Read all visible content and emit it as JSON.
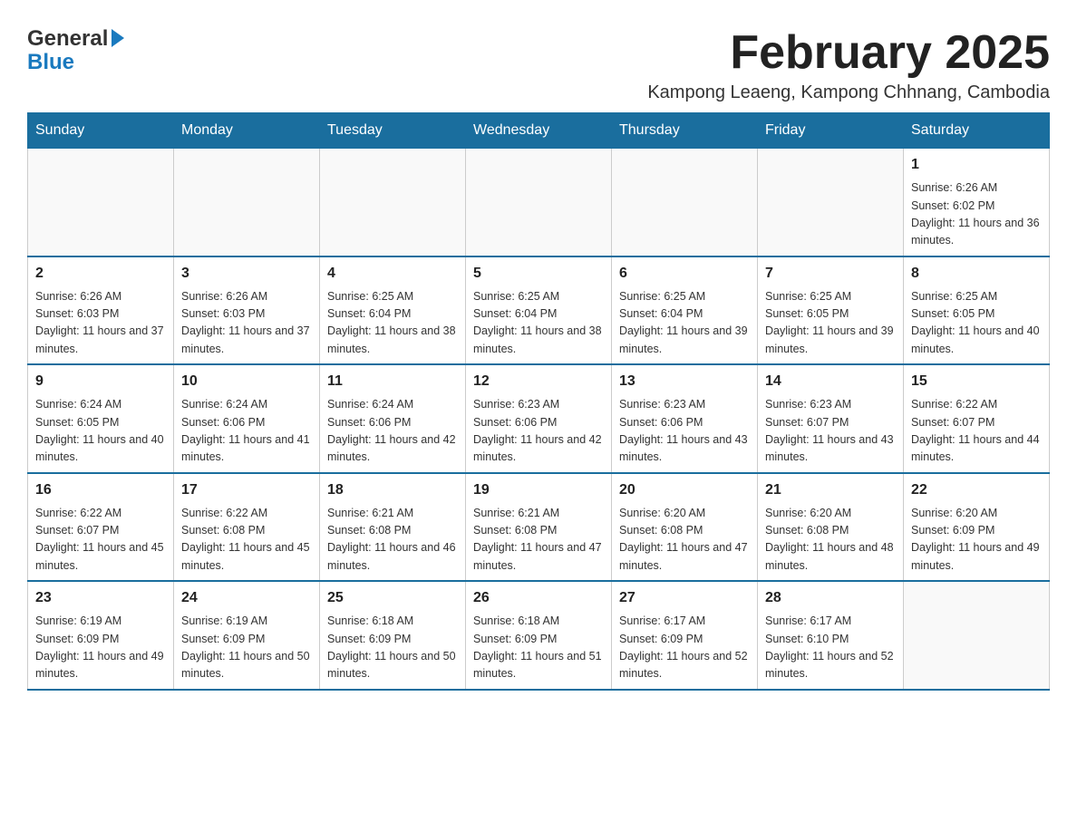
{
  "logo": {
    "general": "General",
    "blue": "Blue"
  },
  "title": "February 2025",
  "subtitle": "Kampong Leaeng, Kampong Chhnang, Cambodia",
  "header_color": "#1a6e9e",
  "days_of_week": [
    "Sunday",
    "Monday",
    "Tuesday",
    "Wednesday",
    "Thursday",
    "Friday",
    "Saturday"
  ],
  "weeks": [
    [
      {
        "day": "",
        "sunrise": "",
        "sunset": "",
        "daylight": ""
      },
      {
        "day": "",
        "sunrise": "",
        "sunset": "",
        "daylight": ""
      },
      {
        "day": "",
        "sunrise": "",
        "sunset": "",
        "daylight": ""
      },
      {
        "day": "",
        "sunrise": "",
        "sunset": "",
        "daylight": ""
      },
      {
        "day": "",
        "sunrise": "",
        "sunset": "",
        "daylight": ""
      },
      {
        "day": "",
        "sunrise": "",
        "sunset": "",
        "daylight": ""
      },
      {
        "day": "1",
        "sunrise": "Sunrise: 6:26 AM",
        "sunset": "Sunset: 6:02 PM",
        "daylight": "Daylight: 11 hours and 36 minutes."
      }
    ],
    [
      {
        "day": "2",
        "sunrise": "Sunrise: 6:26 AM",
        "sunset": "Sunset: 6:03 PM",
        "daylight": "Daylight: 11 hours and 37 minutes."
      },
      {
        "day": "3",
        "sunrise": "Sunrise: 6:26 AM",
        "sunset": "Sunset: 6:03 PM",
        "daylight": "Daylight: 11 hours and 37 minutes."
      },
      {
        "day": "4",
        "sunrise": "Sunrise: 6:25 AM",
        "sunset": "Sunset: 6:04 PM",
        "daylight": "Daylight: 11 hours and 38 minutes."
      },
      {
        "day": "5",
        "sunrise": "Sunrise: 6:25 AM",
        "sunset": "Sunset: 6:04 PM",
        "daylight": "Daylight: 11 hours and 38 minutes."
      },
      {
        "day": "6",
        "sunrise": "Sunrise: 6:25 AM",
        "sunset": "Sunset: 6:04 PM",
        "daylight": "Daylight: 11 hours and 39 minutes."
      },
      {
        "day": "7",
        "sunrise": "Sunrise: 6:25 AM",
        "sunset": "Sunset: 6:05 PM",
        "daylight": "Daylight: 11 hours and 39 minutes."
      },
      {
        "day": "8",
        "sunrise": "Sunrise: 6:25 AM",
        "sunset": "Sunset: 6:05 PM",
        "daylight": "Daylight: 11 hours and 40 minutes."
      }
    ],
    [
      {
        "day": "9",
        "sunrise": "Sunrise: 6:24 AM",
        "sunset": "Sunset: 6:05 PM",
        "daylight": "Daylight: 11 hours and 40 minutes."
      },
      {
        "day": "10",
        "sunrise": "Sunrise: 6:24 AM",
        "sunset": "Sunset: 6:06 PM",
        "daylight": "Daylight: 11 hours and 41 minutes."
      },
      {
        "day": "11",
        "sunrise": "Sunrise: 6:24 AM",
        "sunset": "Sunset: 6:06 PM",
        "daylight": "Daylight: 11 hours and 42 minutes."
      },
      {
        "day": "12",
        "sunrise": "Sunrise: 6:23 AM",
        "sunset": "Sunset: 6:06 PM",
        "daylight": "Daylight: 11 hours and 42 minutes."
      },
      {
        "day": "13",
        "sunrise": "Sunrise: 6:23 AM",
        "sunset": "Sunset: 6:06 PM",
        "daylight": "Daylight: 11 hours and 43 minutes."
      },
      {
        "day": "14",
        "sunrise": "Sunrise: 6:23 AM",
        "sunset": "Sunset: 6:07 PM",
        "daylight": "Daylight: 11 hours and 43 minutes."
      },
      {
        "day": "15",
        "sunrise": "Sunrise: 6:22 AM",
        "sunset": "Sunset: 6:07 PM",
        "daylight": "Daylight: 11 hours and 44 minutes."
      }
    ],
    [
      {
        "day": "16",
        "sunrise": "Sunrise: 6:22 AM",
        "sunset": "Sunset: 6:07 PM",
        "daylight": "Daylight: 11 hours and 45 minutes."
      },
      {
        "day": "17",
        "sunrise": "Sunrise: 6:22 AM",
        "sunset": "Sunset: 6:08 PM",
        "daylight": "Daylight: 11 hours and 45 minutes."
      },
      {
        "day": "18",
        "sunrise": "Sunrise: 6:21 AM",
        "sunset": "Sunset: 6:08 PM",
        "daylight": "Daylight: 11 hours and 46 minutes."
      },
      {
        "day": "19",
        "sunrise": "Sunrise: 6:21 AM",
        "sunset": "Sunset: 6:08 PM",
        "daylight": "Daylight: 11 hours and 47 minutes."
      },
      {
        "day": "20",
        "sunrise": "Sunrise: 6:20 AM",
        "sunset": "Sunset: 6:08 PM",
        "daylight": "Daylight: 11 hours and 47 minutes."
      },
      {
        "day": "21",
        "sunrise": "Sunrise: 6:20 AM",
        "sunset": "Sunset: 6:08 PM",
        "daylight": "Daylight: 11 hours and 48 minutes."
      },
      {
        "day": "22",
        "sunrise": "Sunrise: 6:20 AM",
        "sunset": "Sunset: 6:09 PM",
        "daylight": "Daylight: 11 hours and 49 minutes."
      }
    ],
    [
      {
        "day": "23",
        "sunrise": "Sunrise: 6:19 AM",
        "sunset": "Sunset: 6:09 PM",
        "daylight": "Daylight: 11 hours and 49 minutes."
      },
      {
        "day": "24",
        "sunrise": "Sunrise: 6:19 AM",
        "sunset": "Sunset: 6:09 PM",
        "daylight": "Daylight: 11 hours and 50 minutes."
      },
      {
        "day": "25",
        "sunrise": "Sunrise: 6:18 AM",
        "sunset": "Sunset: 6:09 PM",
        "daylight": "Daylight: 11 hours and 50 minutes."
      },
      {
        "day": "26",
        "sunrise": "Sunrise: 6:18 AM",
        "sunset": "Sunset: 6:09 PM",
        "daylight": "Daylight: 11 hours and 51 minutes."
      },
      {
        "day": "27",
        "sunrise": "Sunrise: 6:17 AM",
        "sunset": "Sunset: 6:09 PM",
        "daylight": "Daylight: 11 hours and 52 minutes."
      },
      {
        "day": "28",
        "sunrise": "Sunrise: 6:17 AM",
        "sunset": "Sunset: 6:10 PM",
        "daylight": "Daylight: 11 hours and 52 minutes."
      },
      {
        "day": "",
        "sunrise": "",
        "sunset": "",
        "daylight": ""
      }
    ]
  ]
}
